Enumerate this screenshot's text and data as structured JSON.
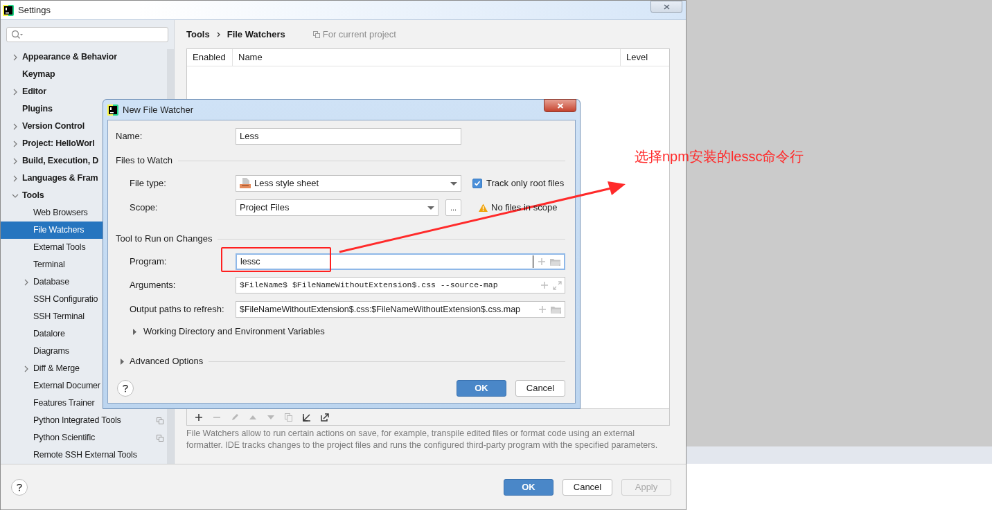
{
  "window": {
    "title": "Settings"
  },
  "sidebar": {
    "items": [
      {
        "label": "Appearance & Behavior",
        "expanded": false
      },
      {
        "label": "Keymap"
      },
      {
        "label": "Editor",
        "expanded": false
      },
      {
        "label": "Plugins"
      },
      {
        "label": "Version Control",
        "expanded": false
      },
      {
        "label": "Project: HelloWorl",
        "expanded": false
      },
      {
        "label": "Build, Execution, D",
        "expanded": false
      },
      {
        "label": "Languages & Fram",
        "expanded": false
      },
      {
        "label": "Tools",
        "expanded": true,
        "children": [
          {
            "label": "Web Browsers",
            "selected": false
          },
          {
            "label": "File Watchers",
            "selected": true
          },
          {
            "label": "External Tools",
            "selected": false
          },
          {
            "label": "Terminal",
            "selected": false
          },
          {
            "label": "Database",
            "selected": false,
            "expanded": false
          },
          {
            "label": "SSH Configuratio",
            "selected": false
          },
          {
            "label": "SSH Terminal",
            "selected": false
          },
          {
            "label": "Datalore",
            "selected": false
          },
          {
            "label": "Diagrams",
            "selected": false
          },
          {
            "label": "Diff & Merge",
            "selected": false,
            "expanded": false
          },
          {
            "label": "External Documer",
            "selected": false
          },
          {
            "label": "Features Trainer",
            "selected": false
          },
          {
            "label": "Python Integrated Tools",
            "selected": false,
            "project_level": true
          },
          {
            "label": "Python Scientific",
            "selected": false,
            "project_level": true
          },
          {
            "label": "Remote SSH External Tools",
            "selected": false
          }
        ]
      }
    ]
  },
  "breadcrumb": [
    "Tools",
    "File Watchers"
  ],
  "scope_note": "For current project",
  "table": {
    "columns": [
      "Enabled",
      "Name",
      "Level"
    ]
  },
  "toolbar": [
    {
      "kind": "add",
      "disabled": false
    },
    {
      "kind": "remove",
      "disabled": true
    },
    {
      "kind": "edit",
      "disabled": true
    },
    {
      "kind": "up",
      "disabled": true
    },
    {
      "kind": "down",
      "disabled": true
    },
    {
      "kind": "copy",
      "disabled": true
    },
    {
      "kind": "import",
      "disabled": false
    },
    {
      "kind": "export",
      "disabled": false
    }
  ],
  "description": "File Watchers allow to run certain actions on save, for example, transpile edited files or format code using an external formatter. IDE tracks changes to the project files and runs the configured third-party program with the specified parameters.",
  "buttons": [
    {
      "label": "OK",
      "kind": "primary",
      "disabled": false
    },
    {
      "label": "Cancel",
      "kind": "default",
      "disabled": false
    },
    {
      "label": "Apply",
      "kind": "default",
      "disabled": true
    }
  ],
  "dialog": {
    "title": "New File Watcher",
    "name": {
      "label": "Name:",
      "value": "Less"
    },
    "files_section": "Files to Watch",
    "file_type": {
      "label": "File type:",
      "value": "Less style sheet"
    },
    "track_root": {
      "label": "Track only root files",
      "checked": true
    },
    "scope": {
      "label": "Scope:",
      "value": "Project Files",
      "button": "..."
    },
    "warning": "No files in scope",
    "tool_section": "Tool to Run on Changes",
    "fields": [
      {
        "label": "Program:",
        "value": "lessc",
        "kind": "browse",
        "focused": true
      },
      {
        "label": "Arguments:",
        "value": "$FileName$ $FileNameWithoutExtension$.css --source-map",
        "kind": "expand",
        "focused": false
      },
      {
        "label": "Output paths to refresh:",
        "value": "$FileNameWithoutExtension$.css:$FileNameWithoutExtension$.css.map",
        "kind": "browse",
        "focused": false
      }
    ],
    "working_dir": {
      "label": "Working Directory and Environment Variables",
      "expanded": false
    },
    "advanced": {
      "label": "Advanced Options",
      "expanded": false
    },
    "buttons": [
      {
        "label": "OK",
        "kind": "primary",
        "disabled": false
      },
      {
        "label": "Cancel",
        "kind": "default",
        "disabled": false
      }
    ]
  },
  "annotation": {
    "text": "选择npm安装的lessc命令行"
  }
}
